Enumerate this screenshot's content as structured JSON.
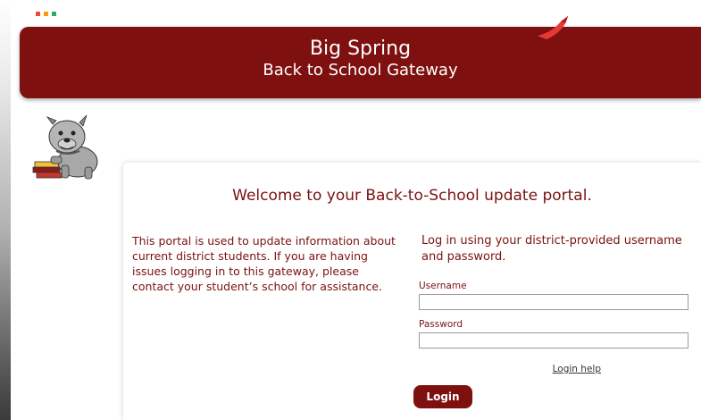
{
  "header": {
    "title": "Big Spring",
    "subtitle": "Back to School Gateway"
  },
  "decor": {
    "dot_colors": [
      "#e74c3c",
      "#f39c12",
      "#27ae60"
    ],
    "swoosh_color": "#e53935",
    "mascot_icon": "bulldog-mascot-icon"
  },
  "welcome": {
    "heading": "Welcome to your Back-to-School update portal."
  },
  "info": {
    "text": "This portal is used to update information about current district students. If you are having issues logging in to this gateway, please contact your student’s school for assistance."
  },
  "login": {
    "instructions": "Log in using your district-provided username and password.",
    "username_label": "Username",
    "username_value": "",
    "password_label": "Password",
    "password_value": "",
    "help_link": "Login help",
    "button_label": "Login"
  },
  "colors": {
    "brand": "#7f1010",
    "accent_text": "#7a1111"
  }
}
